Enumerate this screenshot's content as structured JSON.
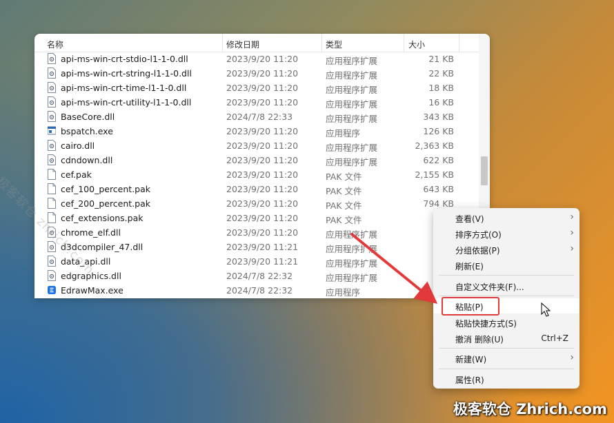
{
  "columns": {
    "name": "名称",
    "date": "修改日期",
    "type": "类型",
    "size": "大小"
  },
  "files": [
    {
      "name": "api-ms-win-crt-stdio-l1-1-0.dll",
      "date": "2023/9/20 11:20",
      "type": "应用程序扩展",
      "size": "21 KB",
      "icon": "dll"
    },
    {
      "name": "api-ms-win-crt-string-l1-1-0.dll",
      "date": "2023/9/20 11:20",
      "type": "应用程序扩展",
      "size": "22 KB",
      "icon": "dll"
    },
    {
      "name": "api-ms-win-crt-time-l1-1-0.dll",
      "date": "2023/9/20 11:20",
      "type": "应用程序扩展",
      "size": "18 KB",
      "icon": "dll"
    },
    {
      "name": "api-ms-win-crt-utility-l1-1-0.dll",
      "date": "2023/9/20 11:20",
      "type": "应用程序扩展",
      "size": "16 KB",
      "icon": "dll"
    },
    {
      "name": "BaseCore.dll",
      "date": "2024/7/8 22:33",
      "type": "应用程序扩展",
      "size": "343 KB",
      "icon": "dll"
    },
    {
      "name": "bspatch.exe",
      "date": "2023/9/20 11:20",
      "type": "应用程序",
      "size": "126 KB",
      "icon": "exe"
    },
    {
      "name": "cairo.dll",
      "date": "2023/9/20 11:20",
      "type": "应用程序扩展",
      "size": "2,363 KB",
      "icon": "dll"
    },
    {
      "name": "cdndown.dll",
      "date": "2023/9/20 11:20",
      "type": "应用程序扩展",
      "size": "622 KB",
      "icon": "dll"
    },
    {
      "name": "cef.pak",
      "date": "2023/9/20 11:20",
      "type": "PAK 文件",
      "size": "2,155 KB",
      "icon": "file"
    },
    {
      "name": "cef_100_percent.pak",
      "date": "2023/9/20 11:20",
      "type": "PAK 文件",
      "size": "643 KB",
      "icon": "file"
    },
    {
      "name": "cef_200_percent.pak",
      "date": "2023/9/20 11:20",
      "type": "PAK 文件",
      "size": "794 KB",
      "icon": "file"
    },
    {
      "name": "cef_extensions.pak",
      "date": "2023/9/20 11:20",
      "type": "PAK 文件",
      "size": "1,7",
      "icon": "file"
    },
    {
      "name": "chrome_elf.dll",
      "date": "2023/9/20 11:20",
      "type": "应用程序扩展",
      "size": "9",
      "icon": "dll"
    },
    {
      "name": "d3dcompiler_47.dll",
      "date": "2023/9/20 11:21",
      "type": "应用程序扩展",
      "size": "4,2",
      "icon": "dll"
    },
    {
      "name": "data_api.dll",
      "date": "2023/9/20 11:21",
      "type": "应用程序扩展",
      "size": "2,6",
      "icon": "dll"
    },
    {
      "name": "edgraphics.dll",
      "date": "2024/7/8 22:32",
      "type": "应用程序扩展",
      "size": "4",
      "icon": "dll"
    },
    {
      "name": "EdrawMax.exe",
      "date": "2024/7/8 22:32",
      "type": "应用程序",
      "size": "6",
      "icon": "app"
    }
  ],
  "menu": {
    "view": "查看(V)",
    "sort": "排序方式(O)",
    "group": "分组依据(P)",
    "refresh": "刷新(E)",
    "customize": "自定义文件夹(F)...",
    "paste": "粘贴(P)",
    "paste_shortcut": "粘贴快捷方式(S)",
    "undo": "撤消 删除(U)",
    "undo_shortcut": "Ctrl+Z",
    "new": "新建(W)",
    "properties": "属性(R)"
  },
  "watermark": {
    "diagonal": "极客软仓 zhrich.com",
    "corner": "极客软仓 Zhrich.com"
  },
  "colors": {
    "highlight": "#e23a3a",
    "accent": "#0067c0"
  }
}
